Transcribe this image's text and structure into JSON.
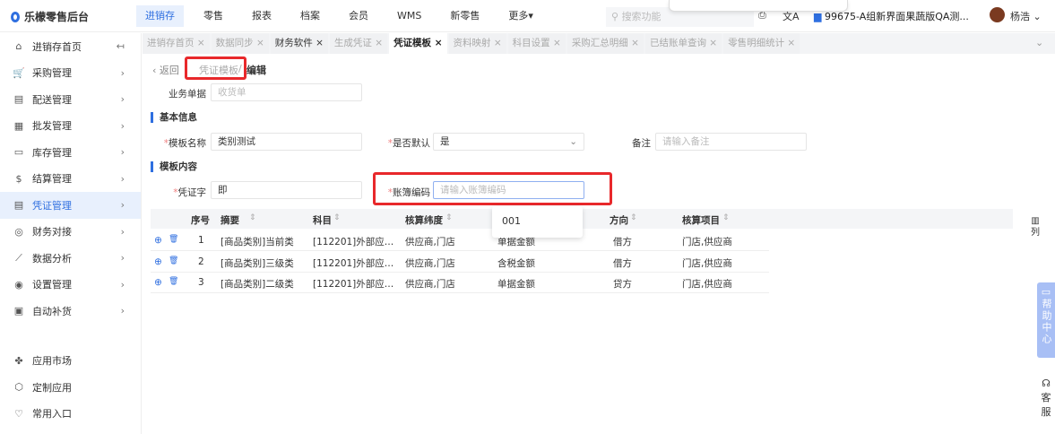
{
  "app": {
    "title": "乐檬零售后台"
  },
  "topnav": {
    "items": [
      "进销存",
      "零售",
      "报表",
      "档案",
      "会员",
      "WMS",
      "新零售",
      "更多▾"
    ],
    "active": 0
  },
  "search": {
    "placeholder": "搜索功能"
  },
  "store": "99675-A组新界面果蔬版QA测...",
  "user": "杨浩",
  "sidebar": {
    "items": [
      {
        "label": "进销存首页",
        "icon": "home-icon"
      },
      {
        "label": "采购管理",
        "icon": "cart-icon"
      },
      {
        "label": "配送管理",
        "icon": "delivery-icon"
      },
      {
        "label": "批发管理",
        "icon": "wholesale-icon"
      },
      {
        "label": "库存管理",
        "icon": "inventory-icon"
      },
      {
        "label": "结算管理",
        "icon": "settlement-icon"
      },
      {
        "label": "凭证管理",
        "icon": "voucher-icon"
      },
      {
        "label": "财务对接",
        "icon": "finance-icon"
      },
      {
        "label": "数据分析",
        "icon": "chart-icon"
      },
      {
        "label": "设置管理",
        "icon": "settings-icon"
      },
      {
        "label": "自动补货",
        "icon": "replenish-icon"
      }
    ],
    "active": 6,
    "bottom": [
      {
        "label": "应用市场",
        "icon": "app-market-icon"
      },
      {
        "label": "定制应用",
        "icon": "custom-app-icon"
      },
      {
        "label": "常用入口",
        "icon": "heart-icon"
      }
    ]
  },
  "tabs": [
    "进销存首页",
    "数据同步",
    "财务软件",
    "生成凭证",
    "凭证模板",
    "资料映射",
    "科目设置",
    "采购汇总明细",
    "已结账单查询",
    "零售明细统计"
  ],
  "active_tab": 4,
  "breadcrumb": {
    "back": "返回",
    "parent": "凭证模板",
    "sep": "/",
    "current": "编辑"
  },
  "form": {
    "biz_doc_label": "业务单据",
    "biz_doc_placeholder": "收货单",
    "basic_title": "基本信息",
    "name_label": "模板名称",
    "name_value": "类别测试",
    "default_label": "是否默认",
    "default_value": "是",
    "remark_label": "备注",
    "remark_placeholder": "请输入备注",
    "content_title": "模板内容",
    "voucher_label": "凭证字",
    "voucher_value": "即",
    "book_label": "账簿编码",
    "book_placeholder": "请输入账簿编码"
  },
  "dropdown": {
    "options": [
      "001"
    ]
  },
  "table": {
    "headers": [
      "序号",
      "摘要",
      "科目",
      "核算纬度",
      "",
      "方向",
      "核算项目"
    ],
    "rows": [
      [
        "1",
        "[商品类别]当前类",
        "[112201]外部应…",
        "供应商,门店",
        "单据金额",
        "借方",
        "门店,供应商"
      ],
      [
        "2",
        "[商品类别]三级类",
        "[112201]外部应…",
        "供应商,门店",
        "含税金额",
        "借方",
        "门店,供应商"
      ],
      [
        "3",
        "[商品类别]二级类",
        "[112201]外部应…",
        "供应商,门店",
        "单据金额",
        "贷方",
        "门店,供应商"
      ]
    ]
  },
  "column_settings": "列",
  "help": "帮助中心",
  "service": "客服"
}
